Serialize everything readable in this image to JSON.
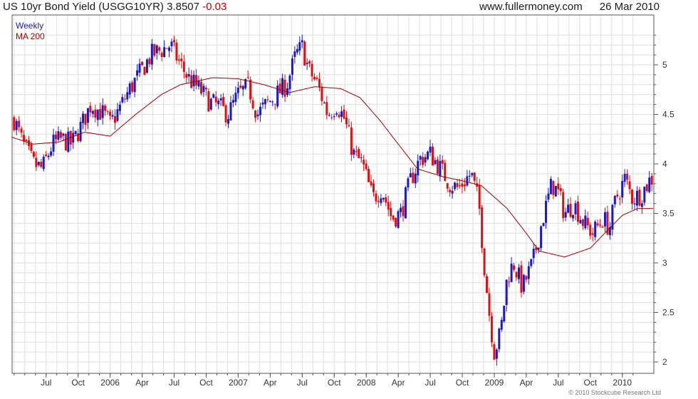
{
  "header": {
    "title": "US 10yr Bond Yield (USGG10YR)",
    "last": "3.8507",
    "change": "-0.03",
    "site": "www.fullermoney.com",
    "date": "26 Mar 2010"
  },
  "legend": {
    "weekly": "Weekly",
    "ma": "MA 200"
  },
  "copyright": "© 2010 Stockcube Research Ltd",
  "colors": {
    "up": "#1a1acc",
    "down": "#dd1111",
    "ma": "#990000",
    "grid": "#dedede",
    "axis": "#555555",
    "legend_weekly": "#1a1a99",
    "legend_ma": "#990000"
  },
  "chart_data": {
    "type": "candlestick",
    "frequency": "weekly",
    "series_names": [
      "Weekly",
      "MA 200"
    ],
    "ylim": [
      1.95,
      5.35
    ],
    "yticks": [
      2,
      2.5,
      3,
      3.5,
      4,
      4.5,
      5
    ],
    "ytick_labels": [
      "2",
      "2.5",
      "3",
      "3.5",
      "4",
      "4.5",
      "5"
    ],
    "xticks": [
      {
        "label": "Jul",
        "t": 2005.5
      },
      {
        "label": "Oct",
        "t": 2005.75
      },
      {
        "label": "2006",
        "t": 2006.0
      },
      {
        "label": "Apr",
        "t": 2006.25
      },
      {
        "label": "Jul",
        "t": 2006.5
      },
      {
        "label": "Oct",
        "t": 2006.75
      },
      {
        "label": "2007",
        "t": 2007.0
      },
      {
        "label": "Apr",
        "t": 2007.25
      },
      {
        "label": "Jul",
        "t": 2007.5
      },
      {
        "label": "Oct",
        "t": 2007.75
      },
      {
        "label": "2008",
        "t": 2008.0
      },
      {
        "label": "Apr",
        "t": 2008.25
      },
      {
        "label": "Jul",
        "t": 2008.5
      },
      {
        "label": "Oct",
        "t": 2008.75
      },
      {
        "label": "2009",
        "t": 2009.0
      },
      {
        "label": "Apr",
        "t": 2009.25
      },
      {
        "label": "Jul",
        "t": 2009.5
      },
      {
        "label": "Oct",
        "t": 2009.75
      },
      {
        "label": "2010",
        "t": 2010.0
      }
    ],
    "x_range": [
      2005.23,
      2010.24
    ],
    "close_keypoints": [
      [
        2005.25,
        4.45
      ],
      [
        2005.32,
        4.2
      ],
      [
        2005.4,
        4.0
      ],
      [
        2005.47,
        3.95
      ],
      [
        2005.55,
        4.2
      ],
      [
        2005.62,
        4.25
      ],
      [
        2005.7,
        4.2
      ],
      [
        2005.78,
        4.4
      ],
      [
        2005.85,
        4.6
      ],
      [
        2005.95,
        4.5
      ],
      [
        2006.0,
        4.4
      ],
      [
        2006.07,
        4.55
      ],
      [
        2006.15,
        4.75
      ],
      [
        2006.25,
        4.95
      ],
      [
        2006.32,
        5.1
      ],
      [
        2006.4,
        5.15
      ],
      [
        2006.47,
        5.2
      ],
      [
        2006.55,
        5.0
      ],
      [
        2006.62,
        4.85
      ],
      [
        2006.7,
        4.75
      ],
      [
        2006.78,
        4.62
      ],
      [
        2006.85,
        4.58
      ],
      [
        2006.92,
        4.5
      ],
      [
        2007.0,
        4.7
      ],
      [
        2007.08,
        4.78
      ],
      [
        2007.15,
        4.5
      ],
      [
        2007.22,
        4.6
      ],
      [
        2007.3,
        4.7
      ],
      [
        2007.38,
        4.8
      ],
      [
        2007.45,
        5.1
      ],
      [
        2007.5,
        5.18
      ],
      [
        2007.55,
        4.95
      ],
      [
        2007.62,
        4.8
      ],
      [
        2007.7,
        4.5
      ],
      [
        2007.77,
        4.6
      ],
      [
        2007.83,
        4.45
      ],
      [
        2007.9,
        4.1
      ],
      [
        2007.97,
        4.0
      ],
      [
        2008.05,
        3.65
      ],
      [
        2008.12,
        3.75
      ],
      [
        2008.2,
        3.45
      ],
      [
        2008.27,
        3.5
      ],
      [
        2008.35,
        3.85
      ],
      [
        2008.42,
        4.05
      ],
      [
        2008.5,
        4.1
      ],
      [
        2008.58,
        3.95
      ],
      [
        2008.65,
        3.8
      ],
      [
        2008.72,
        3.75
      ],
      [
        2008.78,
        3.85
      ],
      [
        2008.82,
        3.9
      ],
      [
        2008.88,
        3.6
      ],
      [
        2008.92,
        3.0
      ],
      [
        2008.96,
        2.5
      ],
      [
        2009.0,
        2.1
      ],
      [
        2009.05,
        2.3
      ],
      [
        2009.1,
        2.85
      ],
      [
        2009.15,
        3.0
      ],
      [
        2009.22,
        2.75
      ],
      [
        2009.3,
        3.0
      ],
      [
        2009.37,
        3.4
      ],
      [
        2009.45,
        3.8
      ],
      [
        2009.5,
        3.7
      ],
      [
        2009.55,
        3.5
      ],
      [
        2009.62,
        3.6
      ],
      [
        2009.7,
        3.4
      ],
      [
        2009.77,
        3.3
      ],
      [
        2009.85,
        3.45
      ],
      [
        2009.9,
        3.35
      ],
      [
        2009.95,
        3.65
      ],
      [
        2010.02,
        3.85
      ],
      [
        2010.08,
        3.65
      ],
      [
        2010.15,
        3.7
      ],
      [
        2010.22,
        3.85
      ]
    ],
    "ma_keypoints": [
      [
        2005.23,
        4.27
      ],
      [
        2005.4,
        4.2
      ],
      [
        2005.6,
        4.22
      ],
      [
        2005.8,
        4.32
      ],
      [
        2006.0,
        4.28
      ],
      [
        2006.2,
        4.5
      ],
      [
        2006.4,
        4.7
      ],
      [
        2006.55,
        4.8
      ],
      [
        2006.8,
        4.87
      ],
      [
        2007.0,
        4.86
      ],
      [
        2007.2,
        4.8
      ],
      [
        2007.4,
        4.72
      ],
      [
        2007.6,
        4.78
      ],
      [
        2007.8,
        4.76
      ],
      [
        2007.95,
        4.67
      ],
      [
        2008.1,
        4.45
      ],
      [
        2008.25,
        4.2
      ],
      [
        2008.4,
        3.95
      ],
      [
        2008.6,
        3.87
      ],
      [
        2008.75,
        3.83
      ],
      [
        2008.9,
        3.78
      ],
      [
        2009.1,
        3.55
      ],
      [
        2009.25,
        3.3
      ],
      [
        2009.35,
        3.12
      ],
      [
        2009.55,
        3.06
      ],
      [
        2009.75,
        3.15
      ],
      [
        2009.9,
        3.35
      ],
      [
        2010.0,
        3.48
      ],
      [
        2010.12,
        3.55
      ],
      [
        2010.24,
        3.55
      ]
    ]
  }
}
